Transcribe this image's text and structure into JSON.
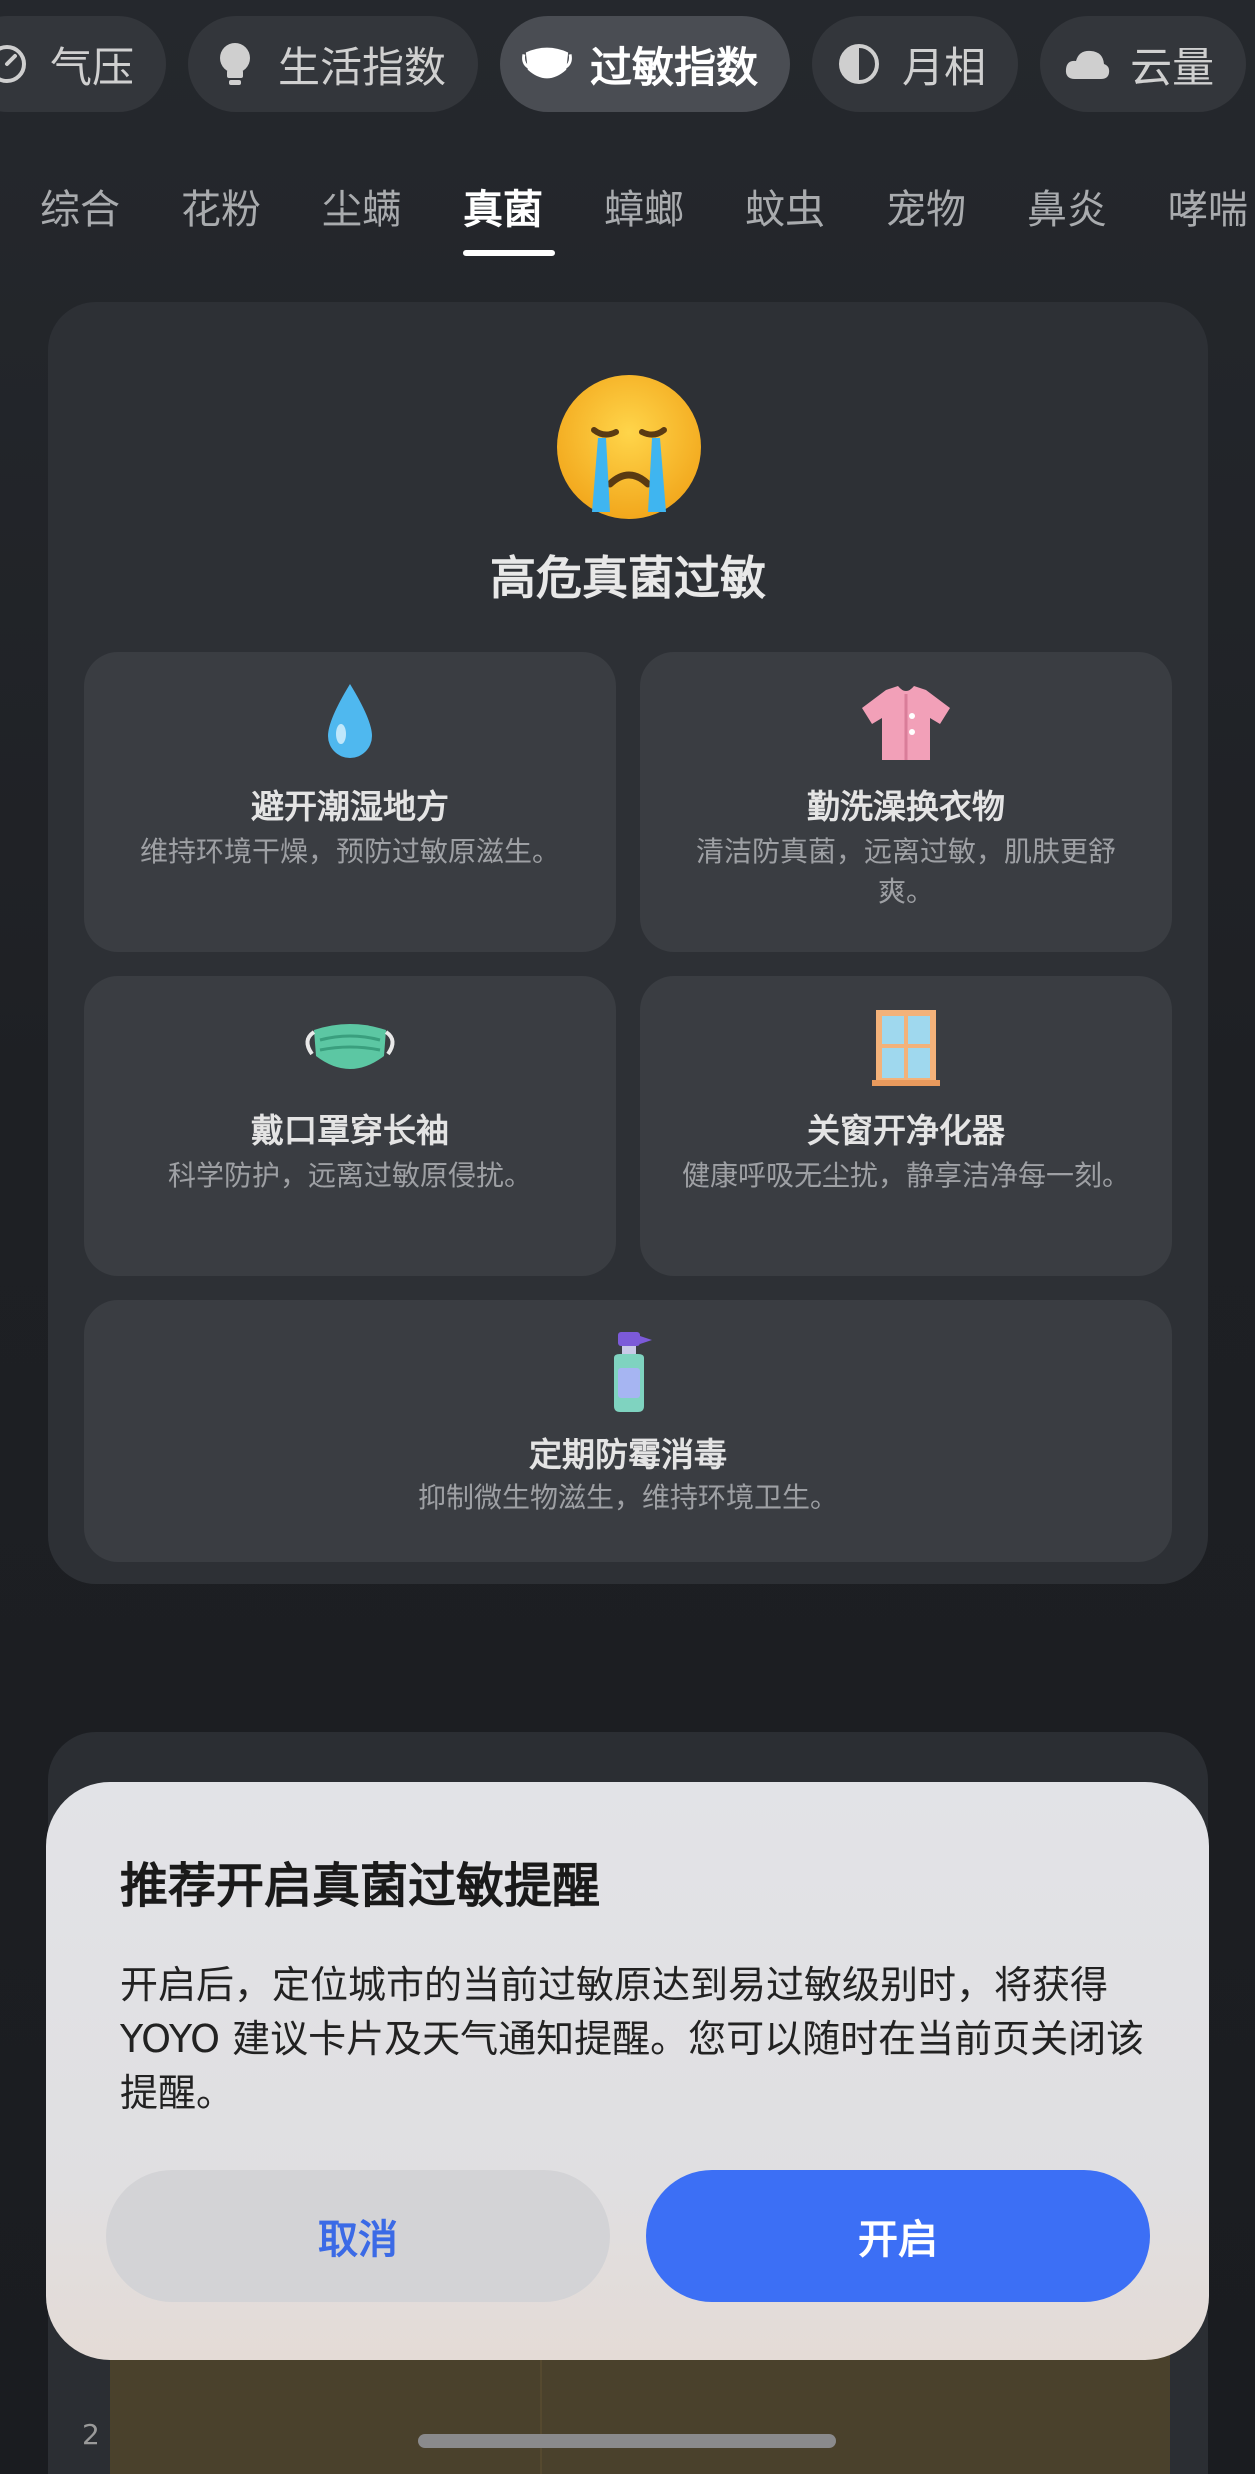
{
  "chips": [
    {
      "label": "气压",
      "icon": "gauge-icon"
    },
    {
      "label": "生活指数",
      "icon": "lightbulb-icon"
    },
    {
      "label": "过敏指数",
      "icon": "mask-icon",
      "active": true
    },
    {
      "label": "月相",
      "icon": "moon-phase-icon"
    },
    {
      "label": "云量",
      "icon": "cloud-icon"
    }
  ],
  "subtabs": [
    "综合",
    "花粉",
    "尘螨",
    "真菌",
    "蟑螂",
    "蚊虫",
    "宠物",
    "鼻炎",
    "哮喘"
  ],
  "active_subtab": "真菌",
  "card": {
    "status_icon": "crying-face-icon",
    "title": "高危真菌过敏",
    "tips": [
      {
        "icon": "droplet-icon",
        "title": "避开潮湿地方",
        "desc": "维持环境干燥，预防过敏原滋生。"
      },
      {
        "icon": "shirt-icon",
        "title": "勤洗澡换衣物",
        "desc": "清洁防真菌，远离过敏，肌肤更舒爽。"
      },
      {
        "icon": "face-mask-icon",
        "title": "戴口罩穿长袖",
        "desc": "科学防护，远离过敏原侵扰。"
      },
      {
        "icon": "window-icon",
        "title": "关窗开净化器",
        "desc": "健康呼吸无尘扰，静享洁净每一刻。"
      },
      {
        "icon": "spray-bottle-icon",
        "title": "定期防霉消毒",
        "desc": "抑制微生物滋生，维持环境卫生。"
      }
    ]
  },
  "chart": {
    "tick_label": "2"
  },
  "dialog": {
    "title": "推荐开启真菌过敏提醒",
    "body": "开启后，定位城市的当前过敏原达到易过敏级别时，将获得 YOYO 建议卡片及天气通知提醒。您可以随时在当前页关闭该提醒。",
    "cancel_label": "取消",
    "confirm_label": "开启",
    "colors": {
      "confirm": "#3c6ff5",
      "cancel_text": "#3b6ae6"
    }
  }
}
